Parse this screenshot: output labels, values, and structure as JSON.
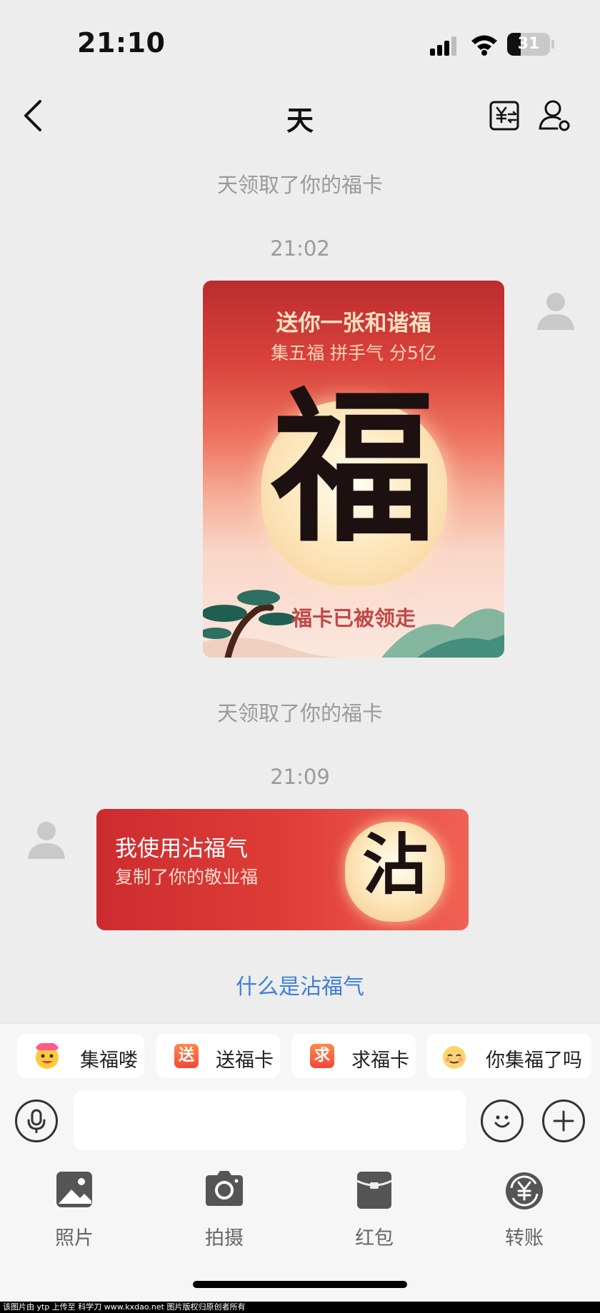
{
  "status_bar": {
    "time": "21:10",
    "battery": "31",
    "battery_level": 0.31
  },
  "nav": {
    "title": "天",
    "back_icon": "chevron-left-icon",
    "transfer_icon": "yuan-transfer-icon",
    "profile_icon": "person-settings-icon"
  },
  "messages": {
    "system_1": "天领取了你的福卡",
    "time_1": "21:02",
    "fu_card": {
      "title": "送你一张和谐福",
      "subtitle": "集五福 拼手气 分5亿",
      "character": "福",
      "status": "福卡已被领走"
    },
    "system_2": "天领取了你的福卡",
    "time_2": "21:09",
    "zhan_card": {
      "title": "我使用沾福气",
      "subtitle": "复制了你的敬业福",
      "character": "沾"
    },
    "link": "什么是沾福气"
  },
  "quick_chips": [
    {
      "label": "集福喽",
      "icon": "sticker-icon"
    },
    {
      "label": "送福卡",
      "icon": "send-card-icon",
      "glyph": "送"
    },
    {
      "label": "求福卡",
      "icon": "request-card-icon",
      "glyph": "求"
    },
    {
      "label": "你集福了吗",
      "icon": "sticker-icon"
    }
  ],
  "input": {
    "value": "",
    "placeholder": ""
  },
  "actions": [
    {
      "label": "照片",
      "icon": "photo-icon"
    },
    {
      "label": "拍摄",
      "icon": "camera-icon"
    },
    {
      "label": "红包",
      "icon": "red-packet-icon"
    },
    {
      "label": "转账",
      "icon": "transfer-icon"
    }
  ],
  "footer": "该图片由 ytp 上传至 科学刀 www.kxdao.net 图片版权归原创者所有"
}
